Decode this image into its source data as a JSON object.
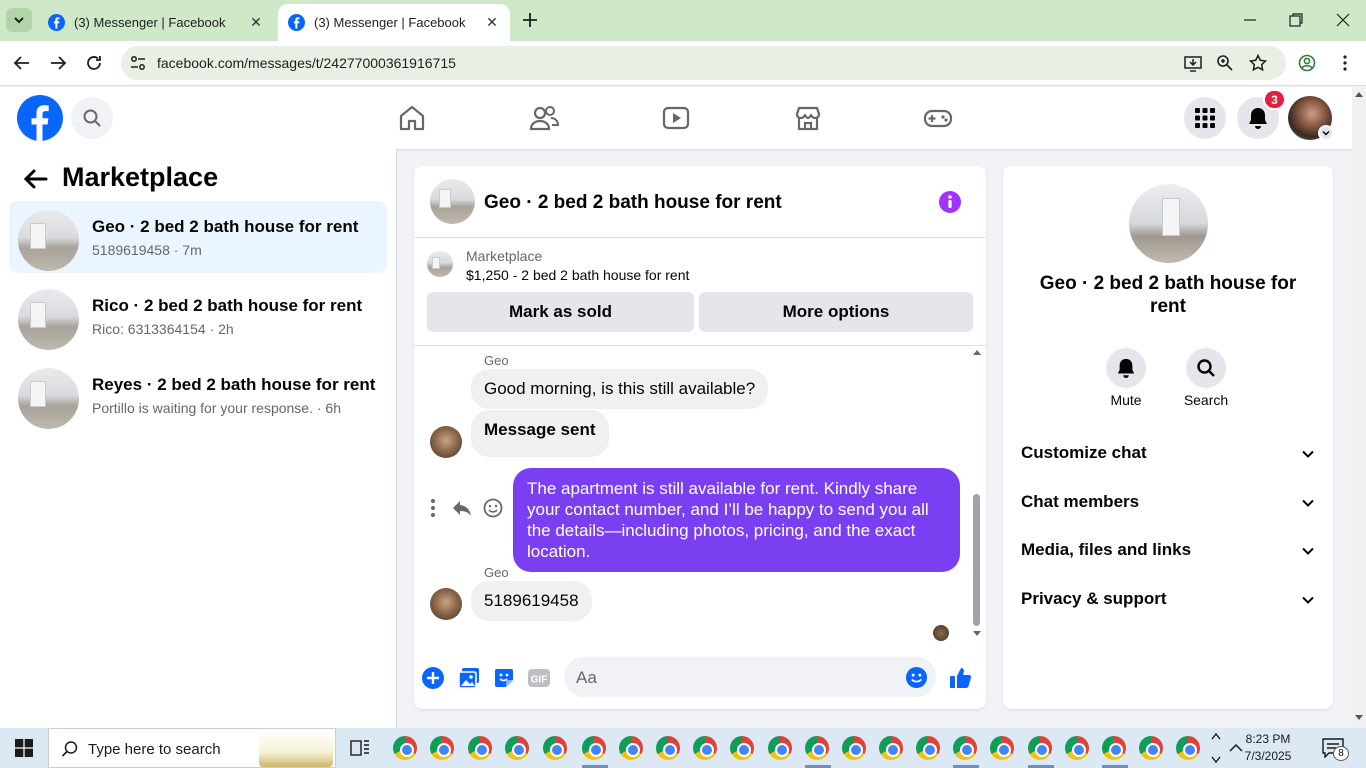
{
  "browser": {
    "tabs": [
      {
        "title": "(3) Messenger | Facebook",
        "active": false
      },
      {
        "title": "(3) Messenger | Facebook",
        "active": true
      }
    ],
    "url": "facebook.com/messages/t/24277000361916715"
  },
  "fb_header": {
    "notifications_count": "3"
  },
  "left_panel": {
    "title": "Marketplace",
    "conversations": [
      {
        "name": "Geo · 2 bed 2 bath house for rent",
        "subtitle": "5189619458 · 7m",
        "selected": true
      },
      {
        "name": "Rico · 2 bed 2 bath house for rent",
        "subtitle": "Rico: 6313364154 · 2h",
        "selected": false
      },
      {
        "name": "Reyes · 2 bed 2 bath house for rent",
        "subtitle": "Portillo is waiting for your response. · 6h",
        "selected": false
      }
    ]
  },
  "chat": {
    "title": "Geo · 2 bed 2 bath house for rent",
    "listing": {
      "category": "Marketplace",
      "price_title": "$1,250 - 2 bed 2 bath house for rent"
    },
    "buttons": {
      "mark_sold": "Mark as sold",
      "more_options": "More options"
    },
    "messages": [
      {
        "sender": "Geo",
        "text": "Good morning, is this still available?"
      },
      {
        "text": "Message sent"
      },
      {
        "text": "The apartment is still available for rent. Kindly share your contact number, and I’ll be happy to send you all the details—including photos, pricing, and the exact location."
      },
      {
        "sender": "Geo",
        "text": "5189619458"
      }
    ],
    "composer_placeholder": "Aa"
  },
  "right_panel": {
    "name": "Geo · 2 bed 2 bath house for rent",
    "actions": {
      "mute": "Mute",
      "search": "Search"
    },
    "sections": [
      {
        "label": "Customize chat"
      },
      {
        "label": "Chat members"
      },
      {
        "label": "Media, files and links"
      },
      {
        "label": "Privacy & support"
      }
    ]
  },
  "taskbar": {
    "search_placeholder": "Type here to search",
    "time": "8:23 PM",
    "date": "7/3/2025",
    "notification_count": "8"
  },
  "colors": {
    "fb_blue": "#0866ff",
    "outgoing_bubble": "#7b3ff2",
    "info_purple": "#a033ff",
    "badge_red": "#e41e3f"
  }
}
